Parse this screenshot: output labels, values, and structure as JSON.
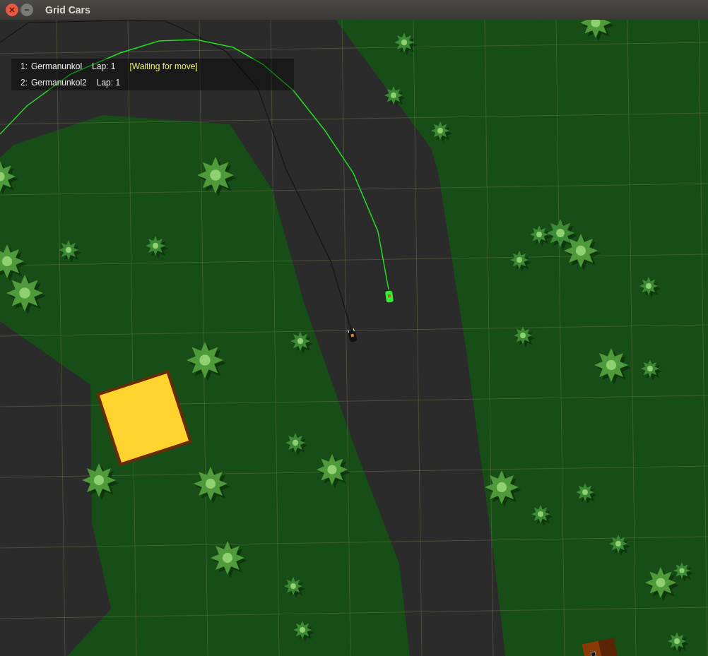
{
  "window": {
    "title": "Grid Cars"
  },
  "players": [
    {
      "position": "1:",
      "name": "Germanunkol",
      "lap": "Lap: 1",
      "status": "[Waiting for move]"
    },
    {
      "position": "2:",
      "name": "Germanunkol2",
      "lap": "Lap: 1"
    }
  ]
}
